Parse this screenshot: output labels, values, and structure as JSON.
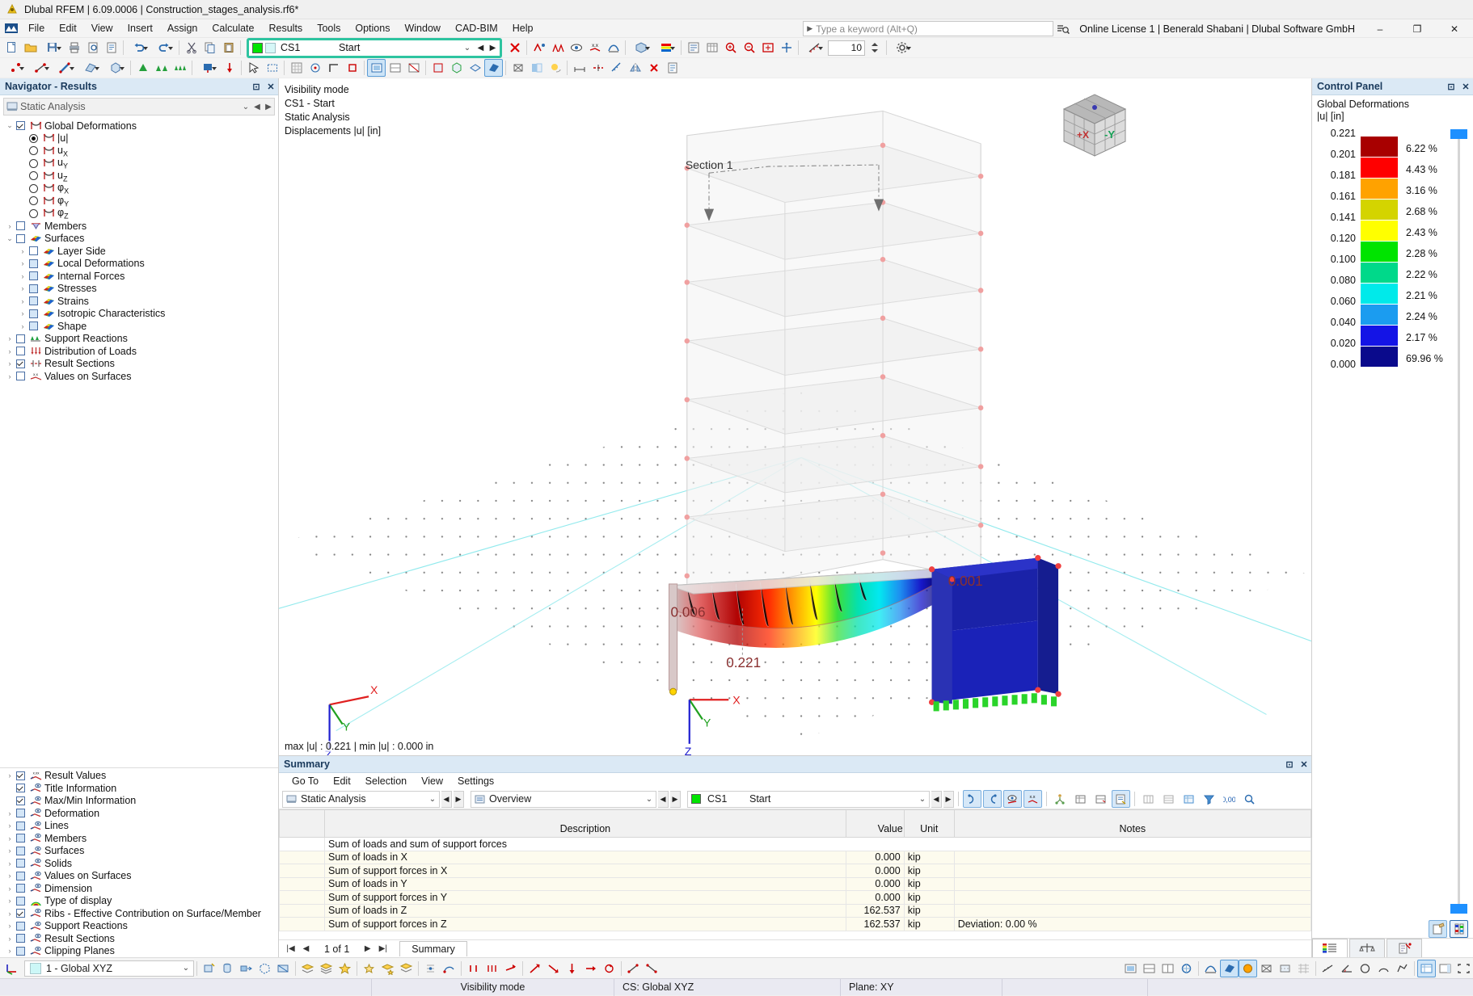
{
  "window": {
    "title": "Dlubal RFEM | 6.09.0006 | Construction_stages_analysis.rf6*",
    "minimize": "–",
    "maximize": "❐",
    "close": "✕"
  },
  "menubar": {
    "items": [
      "File",
      "Edit",
      "View",
      "Insert",
      "Assign",
      "Calculate",
      "Results",
      "Tools",
      "Options",
      "Window",
      "CAD-BIM",
      "Help"
    ],
    "search_placeholder": "Type a keyword (Alt+Q)",
    "license": "Online License 1 | Benerald Shabani | Dlubal Software GmbH"
  },
  "toolbar": {
    "cs_selector": {
      "name": "CS1",
      "description": "Start",
      "chevron": "⌄",
      "prev": "◀",
      "next": "▶"
    },
    "zoom_value": "10"
  },
  "navigator": {
    "title": "Navigator - Results",
    "pin": "⊡",
    "close": "✕",
    "analysis_combo": "Static Analysis",
    "tree": [
      {
        "label": "Global Deformations",
        "indent": 0,
        "control": "checkbox-checked",
        "expander": "v",
        "icon": "deformation-icon"
      },
      {
        "label": "|u|",
        "indent": 1,
        "control": "radio-on",
        "expander": "",
        "icon": "deformation-icon"
      },
      {
        "label": "u<sub>X</sub>",
        "indent": 1,
        "control": "radio",
        "expander": "",
        "icon": "deformation-icon"
      },
      {
        "label": "u<sub>Y</sub>",
        "indent": 1,
        "control": "radio",
        "expander": "",
        "icon": "deformation-icon"
      },
      {
        "label": "u<sub>Z</sub>",
        "indent": 1,
        "control": "radio",
        "expander": "",
        "icon": "deformation-icon"
      },
      {
        "label": "φ<sub>X</sub>",
        "indent": 1,
        "control": "radio",
        "expander": "",
        "icon": "deformation-icon"
      },
      {
        "label": "φ<sub>Y</sub>",
        "indent": 1,
        "control": "radio",
        "expander": "",
        "icon": "deformation-icon"
      },
      {
        "label": "φ<sub>Z</sub>",
        "indent": 1,
        "control": "radio",
        "expander": "",
        "icon": "deformation-icon"
      },
      {
        "label": "Members",
        "indent": 0,
        "control": "checkbox",
        "expander": ">",
        "icon": "member-icon"
      },
      {
        "label": "Surfaces",
        "indent": 0,
        "control": "checkbox",
        "expander": "v",
        "icon": "surface-icon"
      },
      {
        "label": "Layer Side",
        "indent": 1,
        "control": "checkbox",
        "expander": ">",
        "icon": "surface-icon"
      },
      {
        "label": "Local Deformations",
        "indent": 1,
        "control": "checkbox-blue",
        "expander": ">",
        "icon": "surface-icon"
      },
      {
        "label": "Internal Forces",
        "indent": 1,
        "control": "checkbox-blue",
        "expander": ">",
        "icon": "surface-icon"
      },
      {
        "label": "Stresses",
        "indent": 1,
        "control": "checkbox-blue",
        "expander": ">",
        "icon": "surface-icon"
      },
      {
        "label": "Strains",
        "indent": 1,
        "control": "checkbox-blue",
        "expander": ">",
        "icon": "surface-icon"
      },
      {
        "label": "Isotropic Characteristics",
        "indent": 1,
        "control": "checkbox-blue",
        "expander": ">",
        "icon": "surface-icon"
      },
      {
        "label": "Shape",
        "indent": 1,
        "control": "checkbox-blue",
        "expander": ">",
        "icon": "surface-icon"
      },
      {
        "label": "Support Reactions",
        "indent": 0,
        "control": "checkbox",
        "expander": ">",
        "icon": "support-icon"
      },
      {
        "label": "Distribution of Loads",
        "indent": 0,
        "control": "checkbox",
        "expander": ">",
        "icon": "loads-icon"
      },
      {
        "label": "Result Sections",
        "indent": 0,
        "control": "checkbox-checked",
        "expander": ">",
        "icon": "section-icon"
      },
      {
        "label": "Values on Surfaces",
        "indent": 0,
        "control": "checkbox",
        "expander": ">",
        "icon": "values-icon"
      }
    ],
    "display_tree": [
      {
        "label": "Result Values",
        "control": "checkbox-checked",
        "expander": ">",
        "icon": "result-values-icon"
      },
      {
        "label": "Title Information",
        "control": "checkbox-checked",
        "expander": "",
        "icon": "display-icon"
      },
      {
        "label": "Max/Min Information",
        "control": "checkbox-checked",
        "expander": "",
        "icon": "display-icon"
      },
      {
        "label": "Deformation",
        "control": "checkbox-blue",
        "expander": ">",
        "icon": "display-icon"
      },
      {
        "label": "Lines",
        "control": "checkbox-blue",
        "expander": ">",
        "icon": "display-icon"
      },
      {
        "label": "Members",
        "control": "checkbox-blue",
        "expander": ">",
        "icon": "display-icon"
      },
      {
        "label": "Surfaces",
        "control": "checkbox-blue",
        "expander": ">",
        "icon": "display-icon"
      },
      {
        "label": "Solids",
        "control": "checkbox-blue",
        "expander": ">",
        "icon": "display-icon"
      },
      {
        "label": "Values on Surfaces",
        "control": "checkbox-blue",
        "expander": ">",
        "icon": "display-icon"
      },
      {
        "label": "Dimension",
        "control": "checkbox-blue",
        "expander": ">",
        "icon": "display-icon"
      },
      {
        "label": "Type of display",
        "control": "checkbox-blue",
        "expander": ">",
        "icon": "rainbow-icon"
      },
      {
        "label": "Ribs - Effective Contribution on Surface/Member",
        "control": "checkbox-checked",
        "expander": ">",
        "icon": "display-icon"
      },
      {
        "label": "Support Reactions",
        "control": "checkbox-blue",
        "expander": ">",
        "icon": "display-icon"
      },
      {
        "label": "Result Sections",
        "control": "checkbox-blue",
        "expander": ">",
        "icon": "display-icon"
      },
      {
        "label": "Clipping Planes",
        "control": "checkbox-blue",
        "expander": ">",
        "icon": "display-icon"
      }
    ]
  },
  "viewport": {
    "info_lines": [
      "Visibility mode",
      "CS1 - Start",
      "Static Analysis",
      "Displacements |u| [in]"
    ],
    "minmax": "max |u| : 0.221 | min |u| : 0.000 in",
    "section_label": "Section 1",
    "result_labels": [
      "0.006",
      "0.221",
      "0.001"
    ],
    "axis_labels": {
      "x": "X",
      "y": "Y",
      "z": "Z"
    },
    "cube_faces": {
      "front": "+X",
      "right": "-Y"
    }
  },
  "control_panel": {
    "title": "Control Panel",
    "pin": "⊡",
    "close": "✕",
    "heading_line1": "Global Deformations",
    "heading_line2": "|u| [in]",
    "chart_data": {
      "type": "bar",
      "title": "Global Deformations |u| [in]",
      "categories": [
        "0.221",
        "0.201",
        "0.181",
        "0.161",
        "0.141",
        "0.120",
        "0.100",
        "0.080",
        "0.060",
        "0.040",
        "0.020",
        "0.000"
      ],
      "scale_values": [
        "0.221",
        "0.201",
        "0.181",
        "0.161",
        "0.141",
        "0.120",
        "0.100",
        "0.080",
        "0.060",
        "0.040",
        "0.020",
        "0.000"
      ],
      "percentages": [
        "6.22 %",
        "4.43 %",
        "3.16 %",
        "2.68 %",
        "2.43 %",
        "2.28 %",
        "2.22 %",
        "2.21 %",
        "2.24 %",
        "2.17 %",
        "69.96 %"
      ],
      "values": [
        6.22,
        4.43,
        3.16,
        2.68,
        2.43,
        2.28,
        2.22,
        2.21,
        2.24,
        2.17,
        69.96
      ],
      "colors": [
        "#a80000",
        "#ff0000",
        "#ffa200",
        "#d4d400",
        "#ffff00",
        "#00e400",
        "#00d98a",
        "#00eaea",
        "#1b9cf0",
        "#1414e6",
        "#0a0a8c"
      ],
      "xlabel": "",
      "ylabel": "|u| [in]"
    }
  },
  "summary": {
    "title": "Summary",
    "menu": [
      "Go To",
      "Edit",
      "Selection",
      "View",
      "Settings"
    ],
    "analysis_combo": "Static Analysis",
    "view_combo": "Overview",
    "cs_combo": {
      "name": "CS1",
      "description": "Start"
    },
    "columns": [
      "",
      "Description",
      "Value",
      "Unit",
      "Notes"
    ],
    "group_row": "Sum of loads and sum of support forces",
    "rows": [
      {
        "description": "Sum of loads in X",
        "value": "0.000",
        "unit": "kip",
        "notes": ""
      },
      {
        "description": "Sum of support forces in X",
        "value": "0.000",
        "unit": "kip",
        "notes": ""
      },
      {
        "description": "Sum of loads in Y",
        "value": "0.000",
        "unit": "kip",
        "notes": ""
      },
      {
        "description": "Sum of support forces in Y",
        "value": "0.000",
        "unit": "kip",
        "notes": ""
      },
      {
        "description": "Sum of loads in Z",
        "value": "162.537",
        "unit": "kip",
        "notes": ""
      },
      {
        "description": "Sum of support forces in Z",
        "value": "162.537",
        "unit": "kip",
        "notes": "Deviation: 0.00 %"
      }
    ],
    "pager": {
      "first": "|◀",
      "prev": "◀",
      "label": "1 of 1",
      "next": "▶",
      "last": "▶|",
      "tab": "Summary"
    }
  },
  "bottombar": {
    "cs_value": "1 - Global XYZ",
    "chevron": "⌄"
  },
  "statusbar": {
    "mode": "Visibility mode",
    "cs": "CS: Global XYZ",
    "plane": "Plane: XY"
  }
}
